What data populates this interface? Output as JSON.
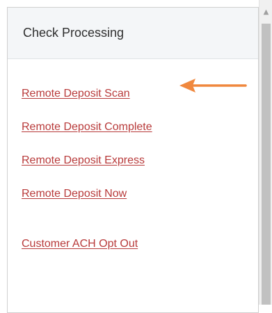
{
  "panel": {
    "title": "Check Processing",
    "links": [
      {
        "label": "Remote Deposit Scan"
      },
      {
        "label": "Remote Deposit Complete"
      },
      {
        "label": "Remote Deposit Express"
      },
      {
        "label": "Remote Deposit Now"
      },
      {
        "label": "Customer ACH Opt Out"
      }
    ]
  },
  "annotation": {
    "arrow_icon": "left-arrow-icon",
    "arrow_color": "#f0883e"
  },
  "scrollbar": {
    "up_icon": "scroll-up-arrow-icon"
  },
  "colors": {
    "link": "#b83a3a",
    "header_bg": "#f4f6f8",
    "title": "#2f2f2f"
  }
}
